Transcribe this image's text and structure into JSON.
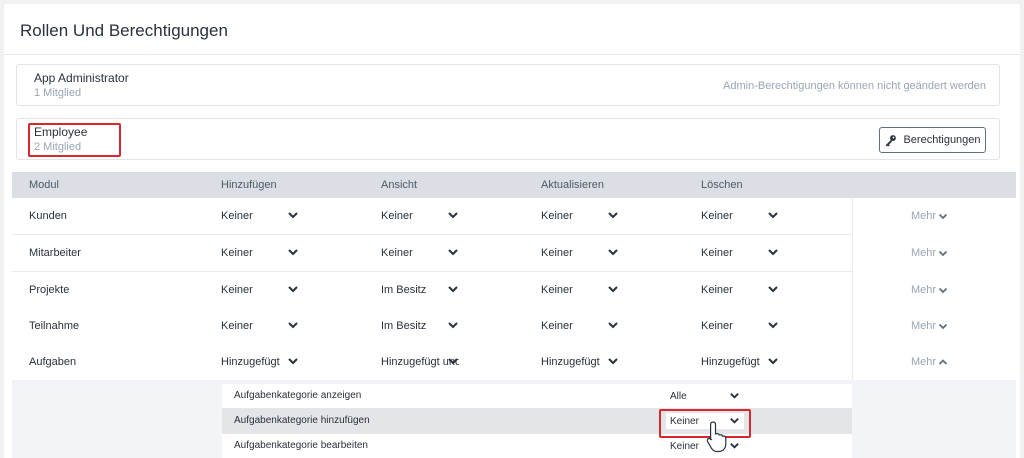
{
  "page": {
    "title": "Rollen Und Berechtigungen"
  },
  "roles": {
    "admin": {
      "name": "App Administrator",
      "count": "1 Mitglied",
      "note": "Admin-Berechtigungen können nicht geändert werden"
    },
    "employee": {
      "name": "Employee",
      "count": "2 Mitglied",
      "button_label": "Berechtigungen",
      "button_icon": "key-icon"
    }
  },
  "table": {
    "headers": [
      "Modul",
      "Hinzufügen",
      "Ansicht",
      "Aktualisieren",
      "Löschen"
    ],
    "rows": [
      {
        "module": "Kunden",
        "values": [
          "Keiner",
          "Keiner",
          "Keiner",
          "Keiner"
        ],
        "more": "Mehr",
        "expanded": false
      },
      {
        "module": "Mitarbeiter",
        "values": [
          "Keiner",
          "Keiner",
          "Keiner",
          "Keiner"
        ],
        "more": "Mehr",
        "expanded": false
      },
      {
        "module": "Projekte",
        "values": [
          "Keiner",
          "Im Besitz",
          "Keiner",
          "Keiner"
        ],
        "more": "Mehr",
        "expanded": false
      },
      {
        "module": "Teilnahme",
        "values": [
          "Keiner",
          "Im Besitz",
          "Keiner",
          "Keiner"
        ],
        "more": "Mehr",
        "expanded": false
      },
      {
        "module": "Aufgaben",
        "values": [
          "Hinzugefügt",
          "Hinzugefügt und Im Besitz",
          "Hinzugefügt",
          "Hinzugefügt"
        ],
        "more": "Mehr",
        "expanded": true
      }
    ]
  },
  "sub_permissions": [
    {
      "label": "Aufgabenkategorie anzeigen",
      "value": "Alle"
    },
    {
      "label": "Aufgabenkategorie hinzufügen",
      "value": "Keiner"
    },
    {
      "label": "Aufgabenkategorie bearbeiten",
      "value": "Keiner"
    }
  ],
  "colors": {
    "text": "#28313c",
    "muted": "#99a5b5",
    "header_bg": "#dbdfe5",
    "highlight": "#d9262f"
  }
}
